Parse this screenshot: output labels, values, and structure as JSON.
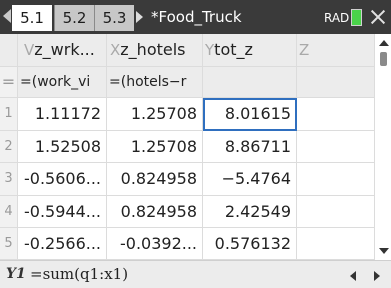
{
  "tabs": [
    {
      "label": "5.1"
    },
    {
      "label": "5.2"
    },
    {
      "label": "5.3"
    }
  ],
  "document_title": "*Food_Truck",
  "angle_mode": "RAD",
  "columns": [
    {
      "letter": "V",
      "name": "z_wrk..."
    },
    {
      "letter": "X",
      "name": "z_hotels"
    },
    {
      "letter": "Y",
      "name": "tot_z"
    },
    {
      "letter": "Z",
      "name": ""
    }
  ],
  "formula_row": {
    "marker": "=",
    "cells": [
      "=(work_vi",
      "=(hotels−r",
      "",
      ""
    ]
  },
  "rows": [
    {
      "num": "1",
      "cells": [
        "1.11172",
        "1.25708",
        "8.01615",
        ""
      ]
    },
    {
      "num": "2",
      "cells": [
        "1.52508",
        "1.25708",
        "8.86711",
        ""
      ]
    },
    {
      "num": "3",
      "cells": [
        "-0.5606...",
        "0.824958",
        "−5.4764",
        ""
      ]
    },
    {
      "num": "4",
      "cells": [
        "-0.5944...",
        "0.824958",
        "2.42549",
        ""
      ]
    },
    {
      "num": "5",
      "cells": [
        "-0.2566...",
        "-0.0392...",
        "0.576132",
        ""
      ]
    }
  ],
  "formula_bar": {
    "cell_ref": "Y1",
    "expression": "=sum(q1:x1)"
  },
  "colors": {
    "tabbar_bg": "#3a3a3a",
    "selection": "#2f6fbf",
    "battery": "#4ad34a"
  }
}
